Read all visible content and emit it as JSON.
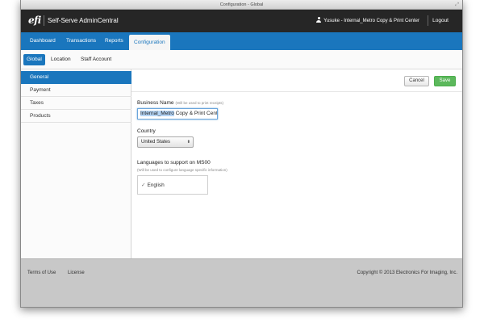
{
  "window": {
    "title": "Configuration - Global"
  },
  "header": {
    "logo": "efi",
    "app_name": "Self-Serve AdminCentral",
    "user_label": "Yusuke - Internal_Metro Copy & Print Center",
    "logout_label": "Logout"
  },
  "main_nav": {
    "tabs": [
      {
        "label": "Dashboard"
      },
      {
        "label": "Transactions"
      },
      {
        "label": "Reports"
      },
      {
        "label": "Configuration",
        "active": true
      }
    ]
  },
  "sub_nav": {
    "tabs": [
      {
        "label": "Global",
        "active": true
      },
      {
        "label": "Location"
      },
      {
        "label": "Staff Account"
      }
    ]
  },
  "sidebar": {
    "items": [
      {
        "label": "General",
        "active": true
      },
      {
        "label": "Payment"
      },
      {
        "label": "Taxes"
      },
      {
        "label": "Products"
      }
    ]
  },
  "form": {
    "cancel_label": "Cancel",
    "save_label": "Save",
    "business_name": {
      "label": "Business Name",
      "hint": "(Will be used to print receipts)",
      "value_selected": "Internal_Metro",
      "value_rest": " Copy & Print Cent"
    },
    "country": {
      "label": "Country",
      "value": "United States"
    },
    "languages": {
      "label": "Languages to support on MS00",
      "hint": "(Will be used to configure language specific information)",
      "options": [
        {
          "label": "English",
          "checked": true
        }
      ]
    }
  },
  "footer": {
    "links": [
      {
        "label": "Terms of Use"
      },
      {
        "label": "License"
      }
    ],
    "copyright": "Copyright © 2013 Electronics For Imaging, Inc."
  },
  "colors": {
    "accent": "#1a76bd",
    "topbar": "#262626",
    "save_green": "#5cb85c"
  }
}
